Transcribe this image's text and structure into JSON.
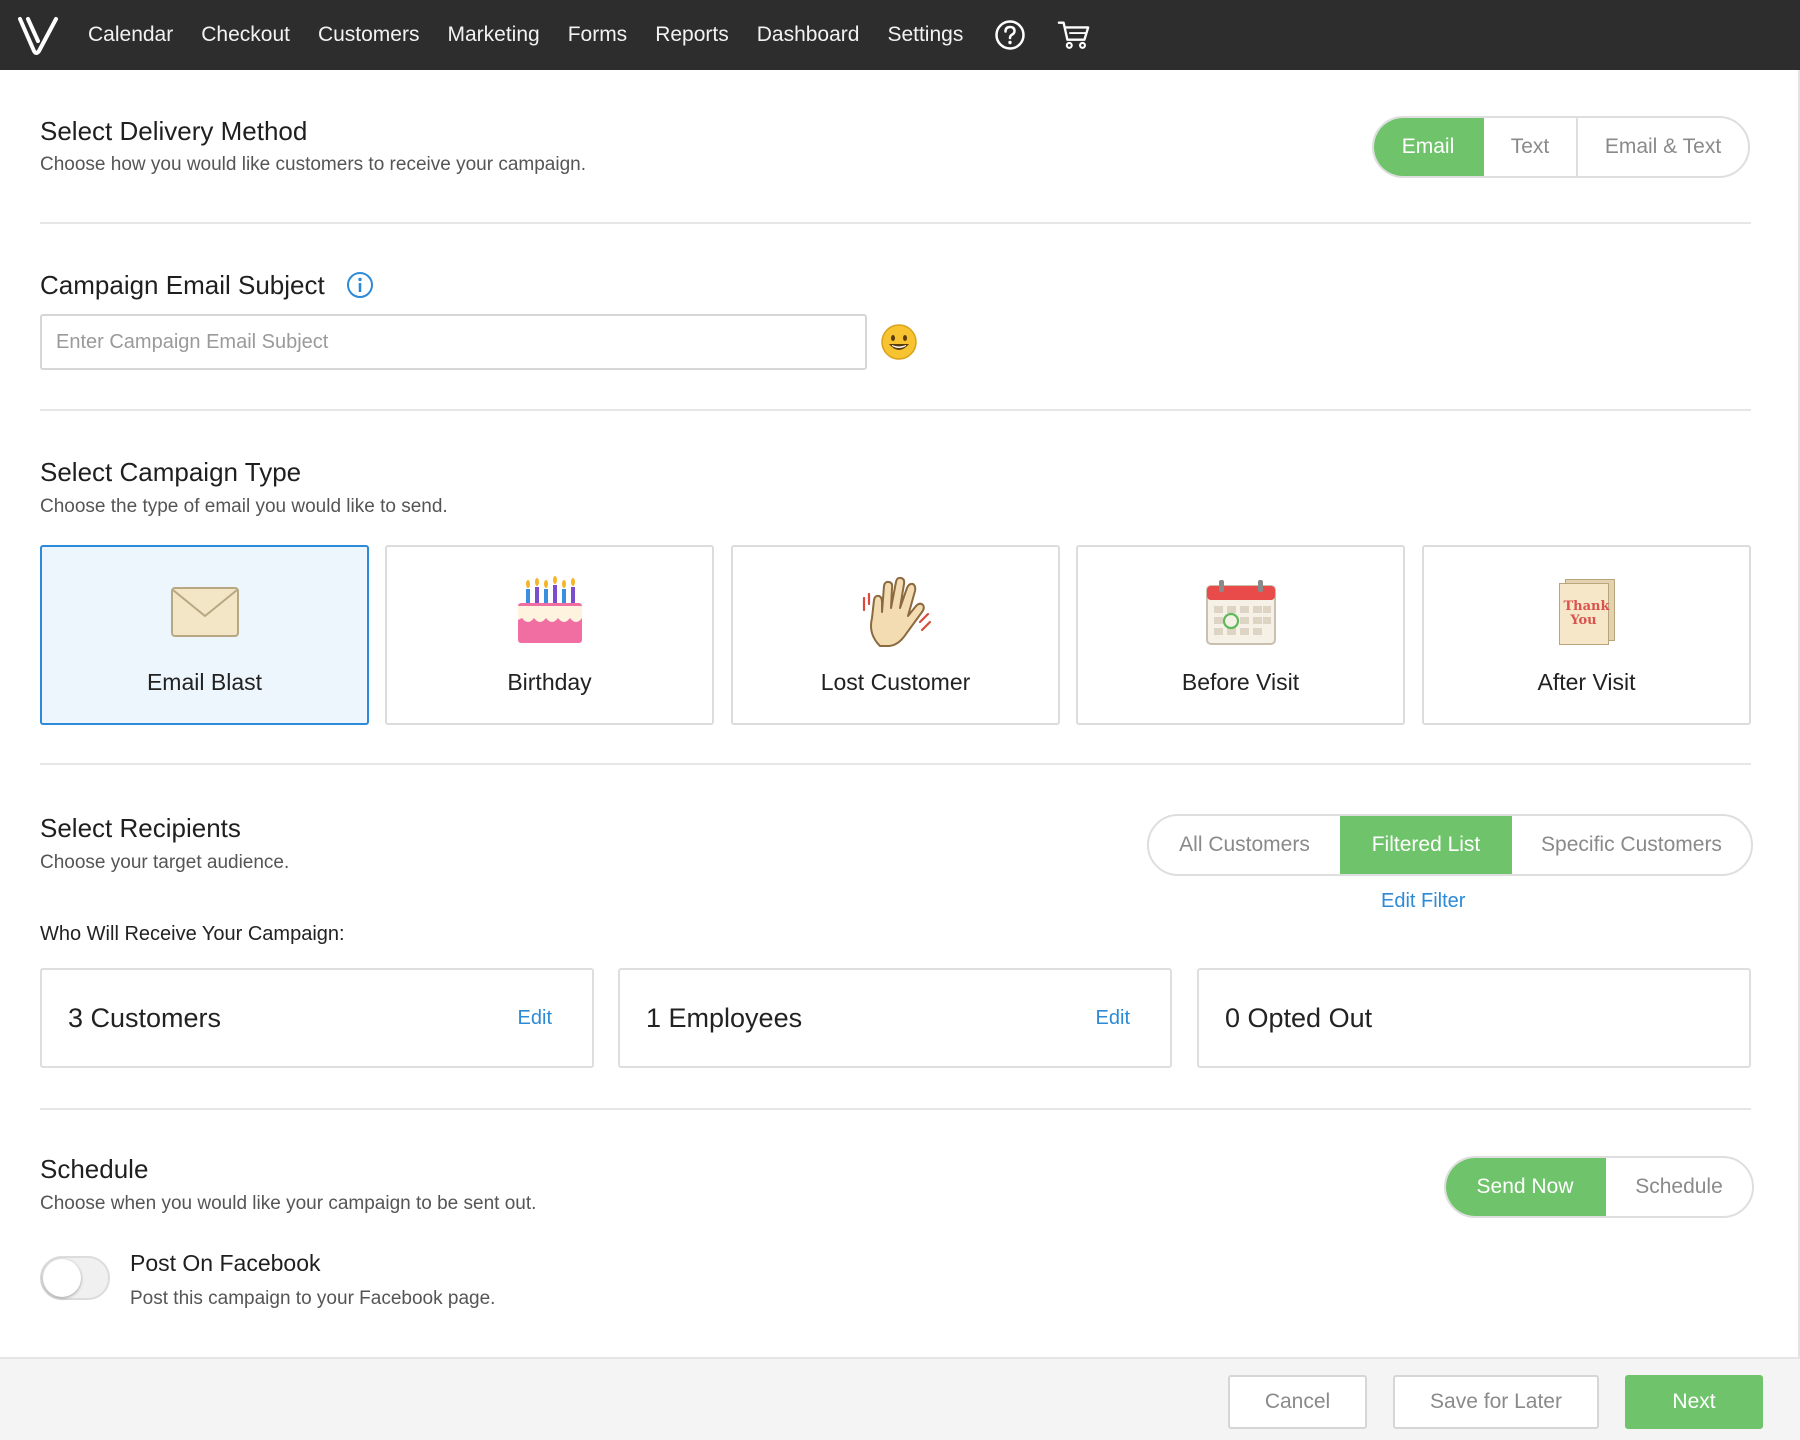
{
  "nav": {
    "items": [
      "Calendar",
      "Checkout",
      "Customers",
      "Marketing",
      "Forms",
      "Reports",
      "Dashboard",
      "Settings"
    ],
    "logo_icon": "v-logo-icon",
    "help_icon": "help-circle-icon",
    "cart_icon": "cart-icon"
  },
  "delivery": {
    "title": "Select Delivery Method",
    "subtitle": "Choose how you would like customers to receive your campaign.",
    "options": [
      "Email",
      "Text",
      "Email & Text"
    ],
    "selected": "Email"
  },
  "subject": {
    "title": "Campaign Email Subject",
    "info_icon": "info-icon",
    "placeholder": "Enter Campaign Email Subject",
    "value": "",
    "emoji_icon": "smiley-emoji-icon"
  },
  "campaign_type": {
    "title": "Select Campaign Type",
    "subtitle": "Choose the type of email you would like to send.",
    "cards": [
      {
        "label": "Email Blast",
        "icon": "envelope-icon",
        "selected": true
      },
      {
        "label": "Birthday",
        "icon": "birthday-cake-icon",
        "selected": false
      },
      {
        "label": "Lost Customer",
        "icon": "waving-hand-icon",
        "selected": false
      },
      {
        "label": "Before Visit",
        "icon": "calendar-icon",
        "selected": false
      },
      {
        "label": "After Visit",
        "icon": "thank-you-card-icon",
        "selected": false
      }
    ],
    "thank_you_text": "Thank You"
  },
  "recipients": {
    "title": "Select Recipients",
    "subtitle": "Choose your target audience.",
    "options": [
      "All Customers",
      "Filtered List",
      "Specific Customers"
    ],
    "selected": "Filtered List",
    "edit_filter": "Edit Filter",
    "who_label": "Who Will Receive Your Campaign:",
    "boxes": [
      {
        "count": "3 Customers",
        "edit": "Edit"
      },
      {
        "count": "1 Employees",
        "edit": "Edit"
      },
      {
        "count": "0 Opted Out",
        "edit": ""
      }
    ]
  },
  "schedule": {
    "title": "Schedule",
    "subtitle": "Choose when you would like your campaign to be sent out.",
    "options": [
      "Send Now",
      "Schedule"
    ],
    "selected": "Send Now",
    "facebook_title": "Post On Facebook",
    "facebook_sub": "Post this campaign to your Facebook page.",
    "facebook_on": false
  },
  "footer": {
    "cancel": "Cancel",
    "save": "Save for Later",
    "next": "Next"
  },
  "colors": {
    "accent_green": "#6fc36a",
    "link_blue": "#2c8ad6",
    "nav_bg": "#2d2d2d"
  }
}
